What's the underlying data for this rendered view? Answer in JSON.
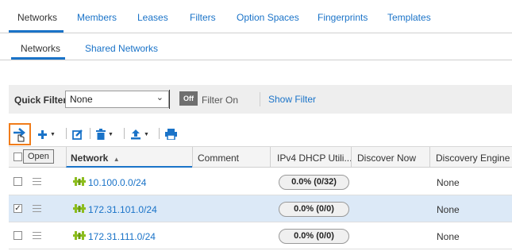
{
  "top_tabs": [
    "Networks",
    "Members",
    "Leases",
    "Filters",
    "Option Spaces",
    "Fingerprints",
    "Templates"
  ],
  "sub_tabs": [
    "Networks",
    "Shared Networks"
  ],
  "quick_filter": {
    "label": "Quick Filter",
    "value": "None",
    "toggle": "Off",
    "filter_on": "Filter On",
    "show_filter": "Show Filter"
  },
  "tooltip": "Open",
  "grid": {
    "columns": [
      "Network",
      "Comment",
      "IPv4 DHCP Utili...",
      "Discover Now",
      "Discovery Engine"
    ],
    "sort_arrow": "▲",
    "rows": [
      {
        "network": "10.100.0.0/24",
        "utilization": "0.0% (0/32)",
        "engine": "None",
        "checked": false
      },
      {
        "network": "172.31.101.0/24",
        "utilization": "0.0% (0/0)",
        "engine": "None",
        "checked": true
      },
      {
        "network": "172.31.111.0/24",
        "utilization": "0.0% (0/0)",
        "engine": "None",
        "checked": false
      }
    ]
  },
  "colors": {
    "accent": "#1a73c8",
    "highlight": "#f07c1a",
    "selected_row": "#dce9f7",
    "network_icon": "#8cbd1e"
  }
}
